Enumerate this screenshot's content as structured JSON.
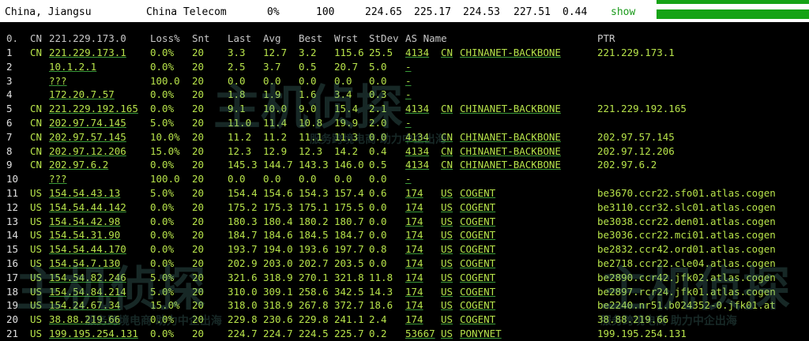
{
  "summary": {
    "location": "China, Jiangsu",
    "isp": "China Telecom",
    "loss": "0%",
    "sent": "100",
    "last": "224.65",
    "avg": "225.17",
    "best": "224.53",
    "worst": "227.51",
    "stdev": "0.44",
    "show_label": "show"
  },
  "columns": {
    "idx": "0.",
    "cc": "CN",
    "host": "221.229.173.0",
    "loss": "Loss%",
    "snt": "Snt",
    "last": "Last",
    "avg": "Avg",
    "best": "Best",
    "wrst": "Wrst",
    "stdev": "StDev",
    "as": "AS Name",
    "ptr": "PTR"
  },
  "hops": [
    {
      "idx": "1",
      "cc": "CN",
      "host": "221.229.173.1",
      "loss": "0.0%",
      "snt": "20",
      "last": "3.3",
      "avg": "12.7",
      "best": "3.2",
      "wrst": "115.6",
      "stdev": "25.5",
      "asn": "4134",
      "ascc": "CN",
      "asname": "CHINANET-BACKBONE",
      "ptr": "221.229.173.1"
    },
    {
      "idx": "2",
      "cc": "",
      "host": "10.1.2.1",
      "loss": "0.0%",
      "snt": "20",
      "last": "2.5",
      "avg": "3.7",
      "best": "0.5",
      "wrst": "20.7",
      "stdev": "5.0",
      "asn": "-",
      "ascc": "",
      "asname": "",
      "ptr": ""
    },
    {
      "idx": "3",
      "cc": "",
      "host": "???",
      "loss": "100.0",
      "snt": "20",
      "last": "0.0",
      "avg": "0.0",
      "best": "0.0",
      "wrst": "0.0",
      "stdev": "0.0",
      "asn": "-",
      "ascc": "",
      "asname": "",
      "ptr": ""
    },
    {
      "idx": "4",
      "cc": "",
      "host": "172.20.7.57",
      "loss": "0.0%",
      "snt": "20",
      "last": "1.8",
      "avg": "1.9",
      "best": "1.6",
      "wrst": "3.4",
      "stdev": "0.3",
      "asn": "-",
      "ascc": "",
      "asname": "",
      "ptr": ""
    },
    {
      "idx": "5",
      "cc": "CN",
      "host": "221.229.192.165",
      "loss": "0.0%",
      "snt": "20",
      "last": "9.1",
      "avg": "10.0",
      "best": "9.0",
      "wrst": "15.4",
      "stdev": "2.1",
      "asn": "4134",
      "ascc": "CN",
      "asname": "CHINANET-BACKBONE",
      "ptr": "221.229.192.165"
    },
    {
      "idx": "6",
      "cc": "CN",
      "host": "202.97.74.145",
      "loss": "5.0%",
      "snt": "20",
      "last": "11.0",
      "avg": "11.4",
      "best": "10.8",
      "wrst": "19.9",
      "stdev": "2.0",
      "asn": "-",
      "ascc": "",
      "asname": "",
      "ptr": ""
    },
    {
      "idx": "7",
      "cc": "CN",
      "host": "202.97.57.145",
      "loss": "10.0%",
      "snt": "20",
      "last": "11.2",
      "avg": "11.2",
      "best": "11.1",
      "wrst": "11.3",
      "stdev": "0.0",
      "asn": "4134",
      "ascc": "CN",
      "asname": "CHINANET-BACKBONE",
      "ptr": "202.97.57.145"
    },
    {
      "idx": "8",
      "cc": "CN",
      "host": "202.97.12.206",
      "loss": "15.0%",
      "snt": "20",
      "last": "12.3",
      "avg": "12.9",
      "best": "12.3",
      "wrst": "14.2",
      "stdev": "0.4",
      "asn": "4134",
      "ascc": "CN",
      "asname": "CHINANET-BACKBONE",
      "ptr": "202.97.12.206"
    },
    {
      "idx": "9",
      "cc": "CN",
      "host": "202.97.6.2",
      "loss": "0.0%",
      "snt": "20",
      "last": "145.3",
      "avg": "144.7",
      "best": "143.3",
      "wrst": "146.0",
      "stdev": "0.5",
      "asn": "4134",
      "ascc": "CN",
      "asname": "CHINANET-BACKBONE",
      "ptr": "202.97.6.2"
    },
    {
      "idx": "10",
      "cc": "",
      "host": "???",
      "loss": "100.0",
      "snt": "20",
      "last": "0.0",
      "avg": "0.0",
      "best": "0.0",
      "wrst": "0.0",
      "stdev": "0.0",
      "asn": "-",
      "ascc": "",
      "asname": "",
      "ptr": ""
    },
    {
      "idx": "11",
      "cc": "US",
      "host": "154.54.43.13",
      "loss": "5.0%",
      "snt": "20",
      "last": "154.4",
      "avg": "154.6",
      "best": "154.3",
      "wrst": "157.4",
      "stdev": "0.6",
      "asn": "174",
      "ascc": "US",
      "asname": "COGENT",
      "ptr": "be3670.ccr22.sfo01.atlas.cogen"
    },
    {
      "idx": "12",
      "cc": "US",
      "host": "154.54.44.142",
      "loss": "0.0%",
      "snt": "20",
      "last": "175.2",
      "avg": "175.3",
      "best": "175.1",
      "wrst": "175.5",
      "stdev": "0.0",
      "asn": "174",
      "ascc": "US",
      "asname": "COGENT",
      "ptr": "be3110.ccr32.slc01.atlas.cogen"
    },
    {
      "idx": "13",
      "cc": "US",
      "host": "154.54.42.98",
      "loss": "0.0%",
      "snt": "20",
      "last": "180.3",
      "avg": "180.4",
      "best": "180.2",
      "wrst": "180.7",
      "stdev": "0.0",
      "asn": "174",
      "ascc": "US",
      "asname": "COGENT",
      "ptr": "be3038.ccr22.den01.atlas.cogen"
    },
    {
      "idx": "14",
      "cc": "US",
      "host": "154.54.31.90",
      "loss": "0.0%",
      "snt": "20",
      "last": "184.7",
      "avg": "184.6",
      "best": "184.5",
      "wrst": "184.7",
      "stdev": "0.0",
      "asn": "174",
      "ascc": "US",
      "asname": "COGENT",
      "ptr": "be3036.ccr22.mci01.atlas.cogen"
    },
    {
      "idx": "15",
      "cc": "US",
      "host": "154.54.44.170",
      "loss": "0.0%",
      "snt": "20",
      "last": "193.7",
      "avg": "194.0",
      "best": "193.6",
      "wrst": "197.7",
      "stdev": "0.8",
      "asn": "174",
      "ascc": "US",
      "asname": "COGENT",
      "ptr": "be2832.ccr42.ord01.atlas.cogen"
    },
    {
      "idx": "16",
      "cc": "US",
      "host": "154.54.7.130",
      "loss": "0.0%",
      "snt": "20",
      "last": "202.9",
      "avg": "203.0",
      "best": "202.7",
      "wrst": "203.5",
      "stdev": "0.0",
      "asn": "174",
      "ascc": "US",
      "asname": "COGENT",
      "ptr": "be2718.ccr22.cle04.atlas.cogen"
    },
    {
      "idx": "17",
      "cc": "US",
      "host": "154.54.82.246",
      "loss": "5.0%",
      "snt": "20",
      "last": "321.6",
      "avg": "318.9",
      "best": "270.1",
      "wrst": "321.8",
      "stdev": "11.8",
      "asn": "174",
      "ascc": "US",
      "asname": "COGENT",
      "ptr": "be2890.ccr42.jfk02.atlas.cogen"
    },
    {
      "idx": "18",
      "cc": "US",
      "host": "154.54.84.214",
      "loss": "5.0%",
      "snt": "20",
      "last": "310.0",
      "avg": "309.1",
      "best": "258.6",
      "wrst": "342.5",
      "stdev": "14.3",
      "asn": "174",
      "ascc": "US",
      "asname": "COGENT",
      "ptr": "be2897.rcr24.jfk01.atlas.cogen"
    },
    {
      "idx": "19",
      "cc": "US",
      "host": "154.24.67.34",
      "loss": "15.0%",
      "snt": "20",
      "last": "318.0",
      "avg": "318.9",
      "best": "267.8",
      "wrst": "372.7",
      "stdev": "18.6",
      "asn": "174",
      "ascc": "US",
      "asname": "COGENT",
      "ptr": "be2240.nr51.b024352-0.jfk01.at"
    },
    {
      "idx": "20",
      "cc": "US",
      "host": "38.88.219.66",
      "loss": "0.0%",
      "snt": "20",
      "last": "229.8",
      "avg": "230.6",
      "best": "229.8",
      "wrst": "241.1",
      "stdev": "2.4",
      "asn": "174",
      "ascc": "US",
      "asname": "COGENT",
      "ptr": "38.88.219.66"
    },
    {
      "idx": "21",
      "cc": "US",
      "host": "199.195.254.131",
      "loss": "0.0%",
      "snt": "20",
      "last": "224.7",
      "avg": "224.7",
      "best": "224.5",
      "wrst": "225.7",
      "stdev": "0.2",
      "asn": "53667",
      "ascc": "US",
      "asname": "PONYNET",
      "ptr": "199.195.254.131"
    }
  ],
  "watermark": {
    "brand": "主机侦探",
    "slogan": "服务跨境电商 助力中企出海"
  }
}
